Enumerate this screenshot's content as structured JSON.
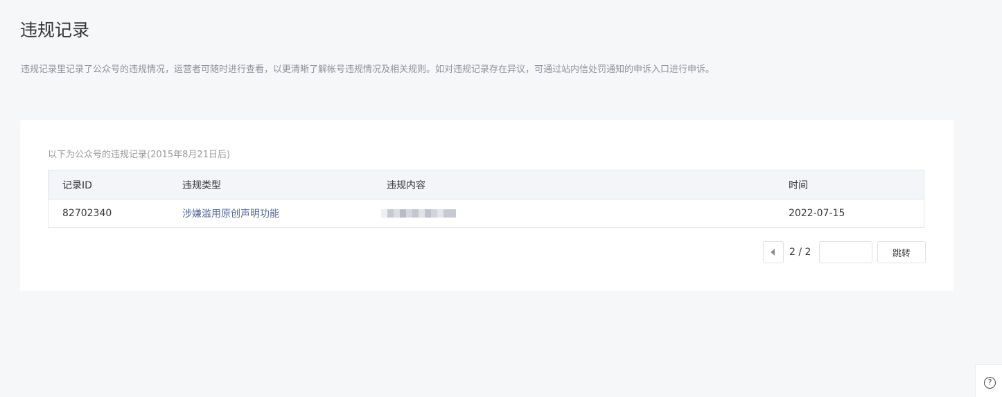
{
  "page": {
    "title": "违规记录",
    "description": "违规记录里记录了公众号的违规情况，运营者可随时进行查看，以更清晰了解帐号违规情况及相关规则。如对违规记录存在异议，可通过站内信处罚通知的申诉入口进行申诉。"
  },
  "records": {
    "caption": "以下为公众号的违规记录(2015年8月21日后)",
    "columns": [
      "记录ID",
      "违规类型",
      "违规内容",
      "时间"
    ],
    "rows": [
      {
        "id": "82702340",
        "type": "涉嫌滥用原创声明功能",
        "content": "",
        "time": "2022-07-15"
      }
    ]
  },
  "pagination": {
    "indicator": "2 / 2",
    "jump_input_placeholder": "",
    "jump_label": "跳转",
    "prev_icon": "triangle-left-icon"
  },
  "help": {
    "icon": "question-circle-icon",
    "glyph": "?"
  },
  "colors": {
    "background": "#f6f7f9",
    "link": "#576b95"
  }
}
